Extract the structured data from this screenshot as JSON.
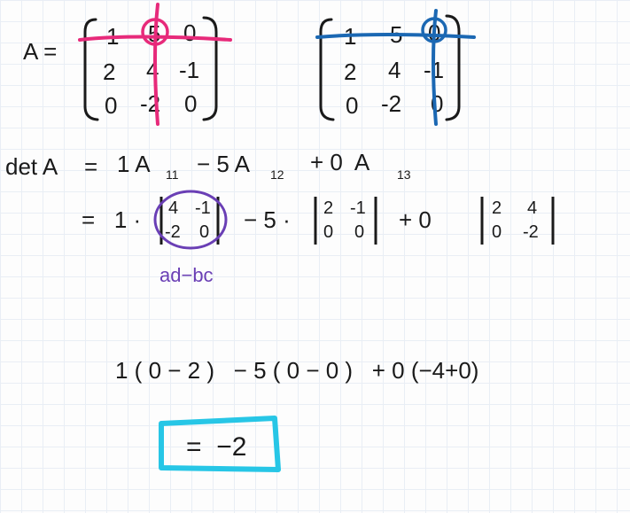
{
  "lhs": "A =",
  "matrix1": {
    "r1c1": "1",
    "r1c2": "5",
    "r1c3": "0",
    "r2c1": "2",
    "r2c2": "4",
    "r2c3": "-1",
    "r3c1": "0",
    "r3c2": "-2",
    "r3c3": "0"
  },
  "matrix2": {
    "r1c1": "1",
    "r1c2": "5",
    "r1c3": "0",
    "r2c1": "2",
    "r2c2": "4",
    "r2c3": "-1",
    "r3c1": "0",
    "r3c2": "-2",
    "r3c3": "0"
  },
  "det_lhs": "det A",
  "eq": "=",
  "cof_line": {
    "t1": "1 A",
    "s1": "11",
    "t2": "− 5 A",
    "s2": "12",
    "t3": "+ 0  A",
    "s3": "13"
  },
  "expand": {
    "lead": "=   1 ·",
    "m1": {
      "a": "4",
      "b": "-1",
      "c": "-2",
      "d": "0"
    },
    "mid1": "− 5 ·",
    "m2": {
      "a": "2",
      "b": "-1",
      "c": "0",
      "d": "0"
    },
    "mid2": "+ 0",
    "m3": {
      "a": "2",
      "b": "4",
      "c": "0",
      "d": "-2"
    }
  },
  "note": "ad−bc",
  "calc": "1 ( 0 − 2 )   − 5 ( 0 − 0 )   + 0 (−4+0)",
  "result": "=  −2"
}
